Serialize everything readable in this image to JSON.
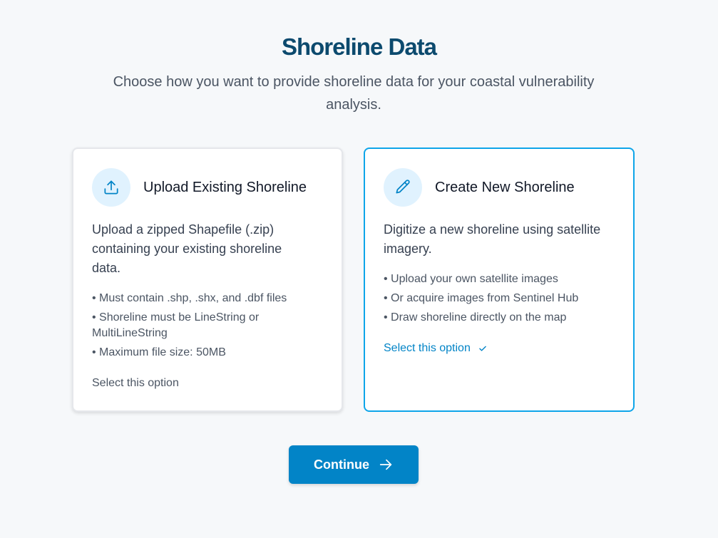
{
  "header": {
    "title": "Shoreline Data",
    "subtitle": "Choose how you want to provide shoreline data for your coastal vulnerability analysis."
  },
  "options": [
    {
      "id": "upload",
      "icon": "upload-icon",
      "title": "Upload Existing Shoreline",
      "description": "Upload a zipped Shapefile (.zip) containing your existing shoreline data.",
      "bullets": [
        "• Must contain .shp, .shx, and .dbf files",
        "• Shoreline must be LineString or MultiLineString",
        "• Maximum file size: 50MB"
      ],
      "select_label": "Select this option",
      "selected": false
    },
    {
      "id": "create",
      "icon": "pencil-icon",
      "title": "Create New Shoreline",
      "description": "Digitize a new shoreline using satellite imagery.",
      "bullets": [
        "• Upload your own satellite images",
        "• Or acquire images from Sentinel Hub",
        "• Draw shoreline directly on the map"
      ],
      "select_label": "Select this option",
      "selected": true
    }
  ],
  "actions": {
    "continue_label": "Continue"
  },
  "colors": {
    "title": "#0c4a6e",
    "accent": "#0284c7",
    "selected_border": "#0ea5e9",
    "icon_bg": "#e0f2fe",
    "background": "#f6f8fa"
  }
}
